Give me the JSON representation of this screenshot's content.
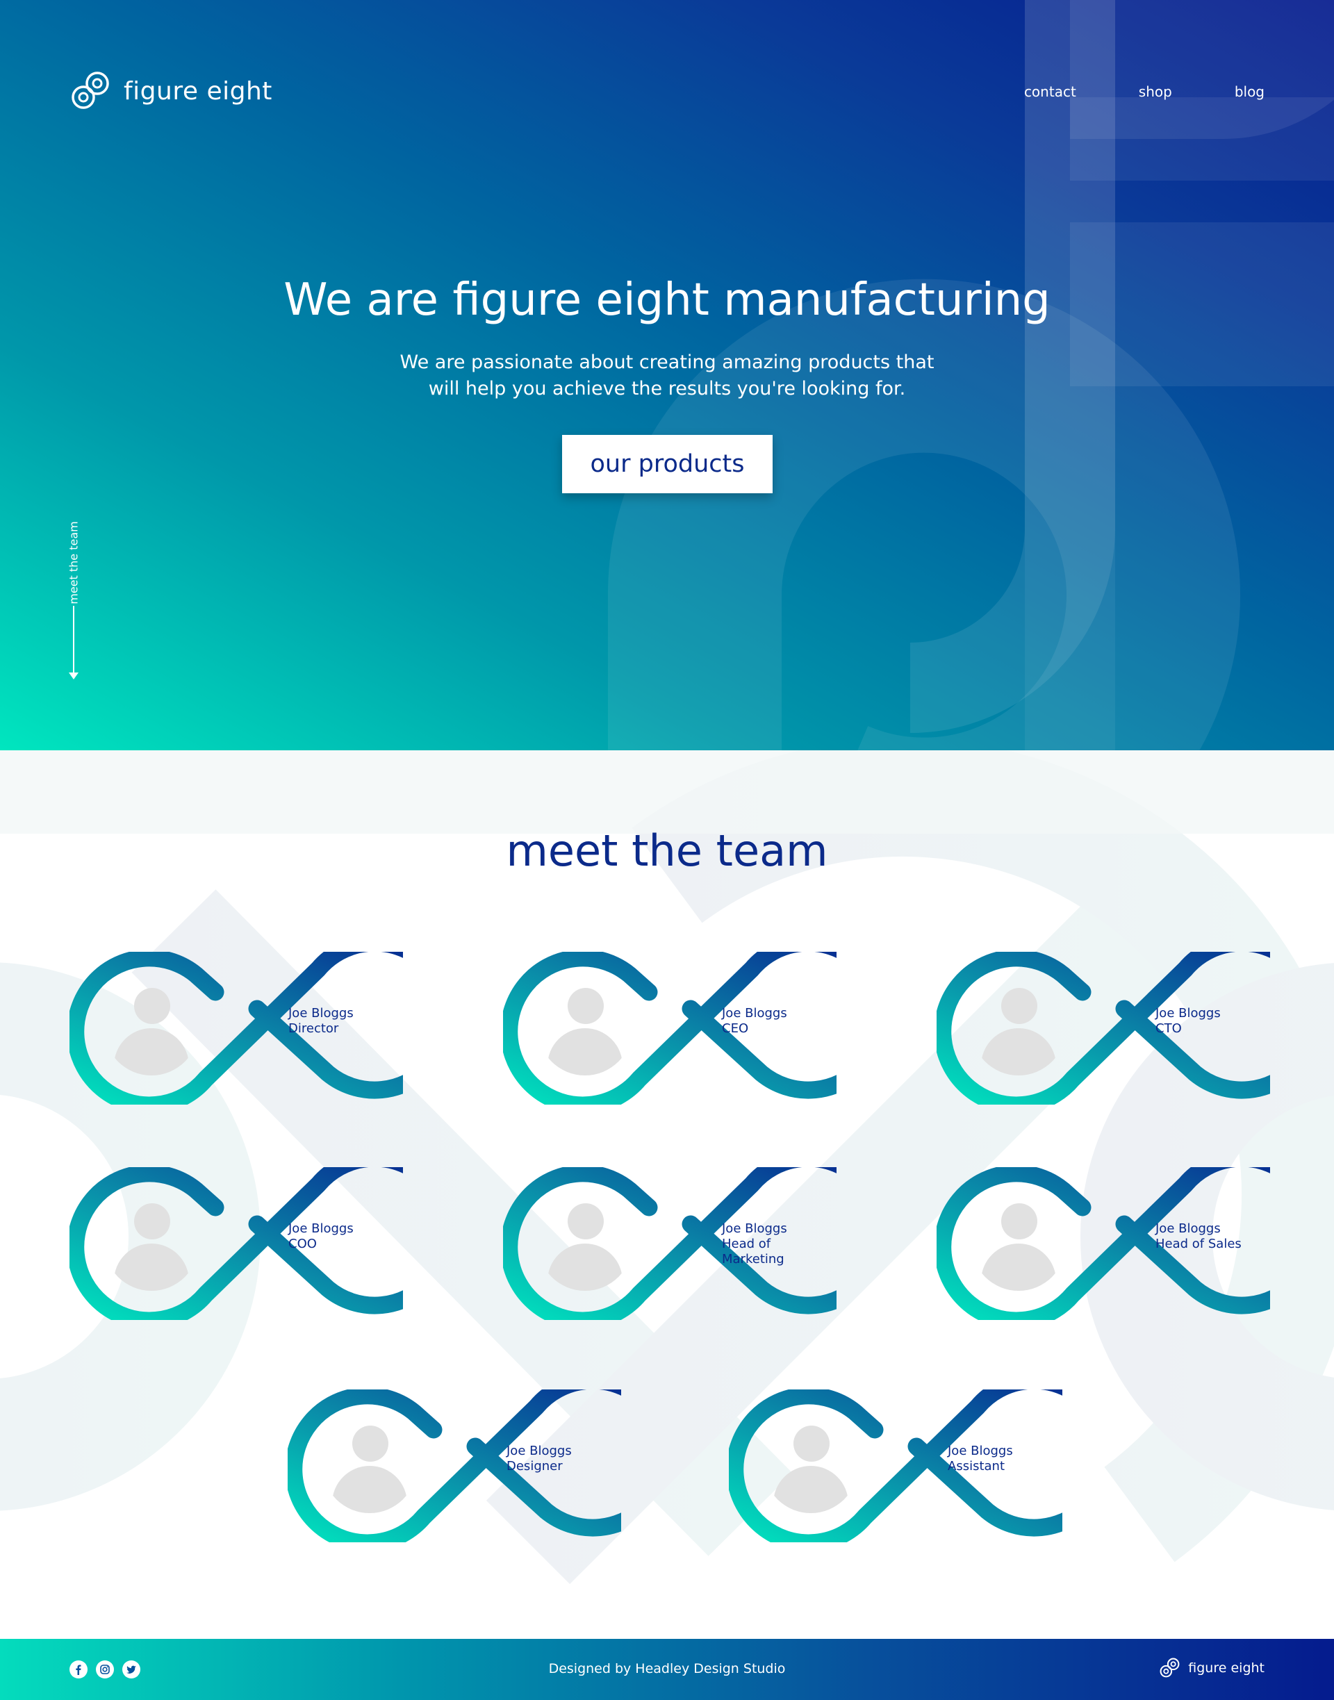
{
  "brand": {
    "name": "figure eight",
    "logo_icon": "figure-eight-logo-icon"
  },
  "nav": {
    "items": [
      {
        "label": "contact"
      },
      {
        "label": "shop"
      },
      {
        "label": "blog"
      }
    ]
  },
  "hero": {
    "title": "We are figure eight manufacturing",
    "subtitle_line1": "We are passionate about creating amazing products that",
    "subtitle_line2": "will help you achieve the results you're looking for.",
    "cta_label": "our products",
    "scroll_hint": "meet the team"
  },
  "team": {
    "title": "meet the team",
    "members": [
      {
        "name": "Joe Bloggs",
        "role": "Director"
      },
      {
        "name": "Joe Bloggs",
        "role": "CEO"
      },
      {
        "name": "Joe Bloggs",
        "role": "CTO"
      },
      {
        "name": "Joe Bloggs",
        "role": "COO"
      },
      {
        "name": "Joe Bloggs",
        "role": "Head of Marketing"
      },
      {
        "name": "Joe Bloggs",
        "role": "Head of Sales"
      },
      {
        "name": "Joe Bloggs",
        "role": "Designer"
      },
      {
        "name": "Joe Bloggs",
        "role": "Assistant"
      }
    ]
  },
  "footer": {
    "social": [
      {
        "icon": "facebook-icon"
      },
      {
        "icon": "instagram-icon"
      },
      {
        "icon": "twitter-icon"
      }
    ],
    "credit": "Designed by Headley Design Studio",
    "brand": "figure eight"
  },
  "colors": {
    "primary_navy": "#0b2a8a",
    "teal": "#00e6bf",
    "deep_blue": "#051b8e",
    "avatar_grey": "#e1e1e1"
  }
}
